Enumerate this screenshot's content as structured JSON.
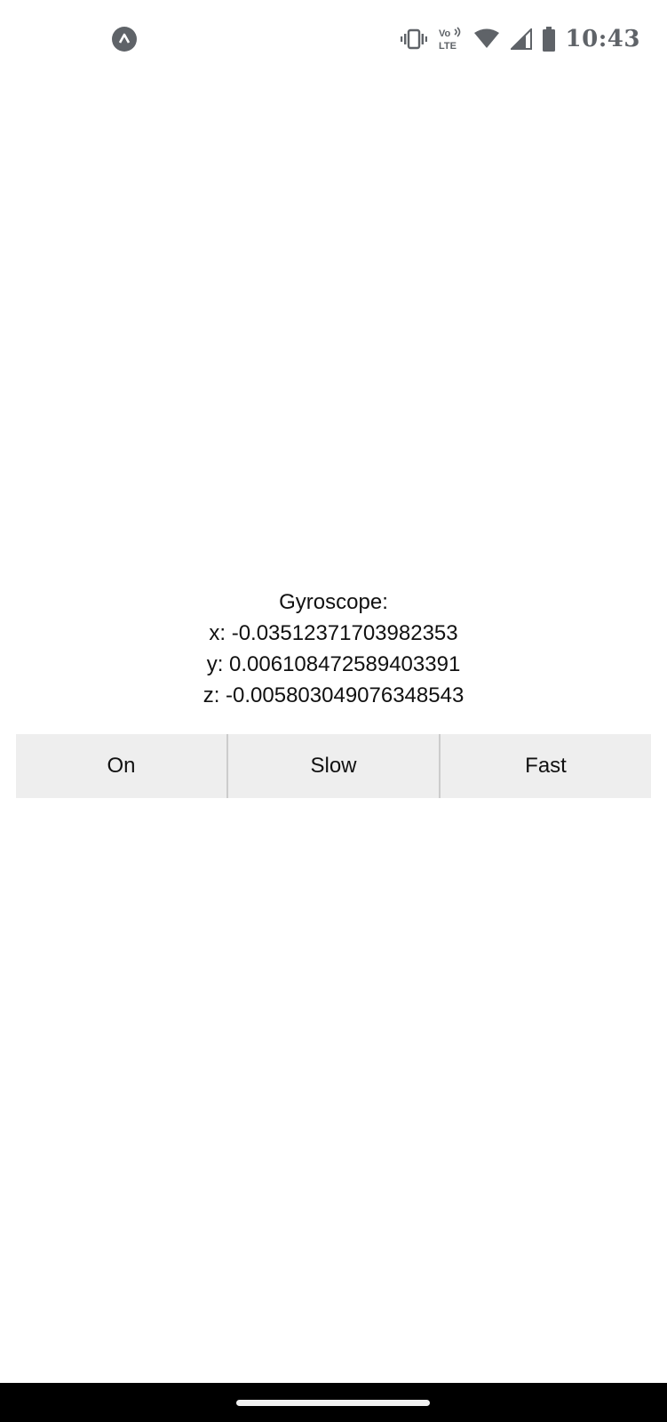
{
  "status_bar": {
    "app_icon": "expo-caret-icon",
    "icons": [
      "vibrate-icon",
      "volte-icon",
      "wifi-icon",
      "cell-signal-icon",
      "battery-icon"
    ],
    "volte_top": "Vo",
    "volte_bottom": "LTE",
    "time": "10:43"
  },
  "gyroscope": {
    "title": "Gyroscope:",
    "x": "x: -0.03512371703982353",
    "y": "y: 0.006108472589403391",
    "z": "z: -0.005803049076348543"
  },
  "buttons": {
    "on": "On",
    "slow": "Slow",
    "fast": "Fast"
  },
  "colors": {
    "button_background": "#eeeeee",
    "status_icon": "#5f6368",
    "nav_bar": "#000000"
  }
}
